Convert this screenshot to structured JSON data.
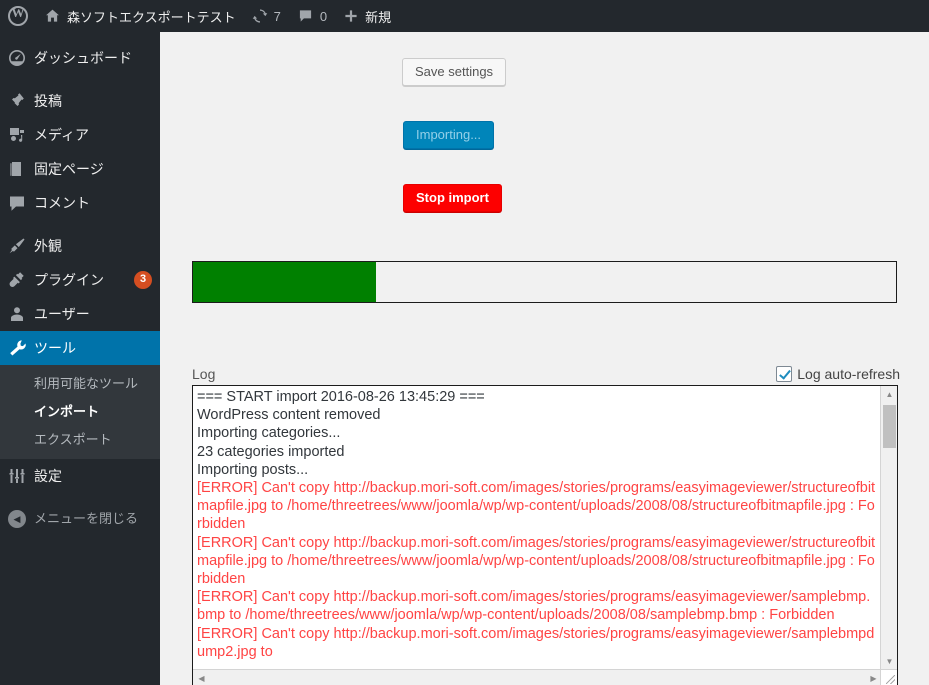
{
  "adminbar": {
    "logo_icon": "wordpress-logo-icon",
    "home_icon": "home-icon",
    "site_name": "森ソフトエクスポートテスト",
    "updates_icon": "updates-icon",
    "updates_count": "7",
    "comments_icon": "comment-bubble-icon",
    "comments_count": "0",
    "new_icon": "plus-icon",
    "new_label": "新規"
  },
  "sidebar": {
    "items": [
      {
        "label": "ダッシュボード",
        "icon": "dashboard-icon",
        "name": "dashboard"
      },
      {
        "label": "投稿",
        "icon": "pin-icon",
        "name": "posts"
      },
      {
        "label": "メディア",
        "icon": "media-icon",
        "name": "media"
      },
      {
        "label": "固定ページ",
        "icon": "page-icon",
        "name": "pages"
      },
      {
        "label": "コメント",
        "icon": "comment-icon",
        "name": "comments"
      },
      {
        "label": "外観",
        "icon": "appearance-brush-icon",
        "name": "appearance"
      },
      {
        "label": "プラグイン",
        "icon": "plugin-plug-icon",
        "name": "plugins",
        "badge": "3"
      },
      {
        "label": "ユーザー",
        "icon": "user-icon",
        "name": "users"
      },
      {
        "label": "ツール",
        "icon": "tools-wrench-icon",
        "name": "tools",
        "current": true
      },
      {
        "label": "設定",
        "icon": "settings-sliders-icon",
        "name": "settings"
      }
    ],
    "submenu": [
      {
        "label": "利用可能なツール",
        "name": "available-tools"
      },
      {
        "label": "インポート",
        "name": "import",
        "current": true
      },
      {
        "label": "エクスポート",
        "name": "export"
      }
    ],
    "collapse": {
      "label": "メニューを閉じる",
      "icon": "collapse-arrow-icon"
    }
  },
  "main": {
    "save_label": "Save settings",
    "importing_label": "Importing...",
    "stop_label": "Stop import",
    "progress_percent": 26,
    "progress_color": "#008000",
    "log_label": "Log",
    "autorefresh_label": "Log auto-refresh",
    "autorefresh_checked": true,
    "log_lines": [
      {
        "text": "=== START import 2016-08-26 13:45:29 ===",
        "error": false
      },
      {
        "text": "WordPress content removed",
        "error": false
      },
      {
        "text": "Importing categories...",
        "error": false
      },
      {
        "text": "23 categories imported",
        "error": false
      },
      {
        "text": "Importing posts...",
        "error": false
      },
      {
        "text": "[ERROR] Can't copy http://backup.mori-soft.com/images/stories/programs/easyimageviewer/structureofbitmapfile.jpg to /home/threetrees/www/joomla/wp/wp-content/uploads/2008/08/structureofbitmapfile.jpg : Forbidden",
        "error": true
      },
      {
        "text": "[ERROR] Can't copy http://backup.mori-soft.com/images/stories/programs/easyimageviewer/structureofbitmapfile.jpg to /home/threetrees/www/joomla/wp/wp-content/uploads/2008/08/structureofbitmapfile.jpg : Forbidden",
        "error": true
      },
      {
        "text": "[ERROR] Can't copy http://backup.mori-soft.com/images/stories/programs/easyimageviewer/samplebmp.bmp to /home/threetrees/www/joomla/wp/wp-content/uploads/2008/08/samplebmp.bmp : Forbidden",
        "error": true
      },
      {
        "text": "[ERROR] Can't copy http://backup.mori-soft.com/images/stories/programs/easyimageviewer/samplebmpdump2.jpg to",
        "error": true
      }
    ],
    "scroll": {
      "up_arrow": "▲",
      "down_arrow": "▼",
      "left_arrow": "◀",
      "right_arrow": "▶"
    }
  },
  "colors": {
    "admin_blue": "#0073aa",
    "badge_orange": "#d54e21",
    "progress_green": "#008000",
    "error_red": "#ff4444",
    "stop_red": "#fd0000"
  }
}
